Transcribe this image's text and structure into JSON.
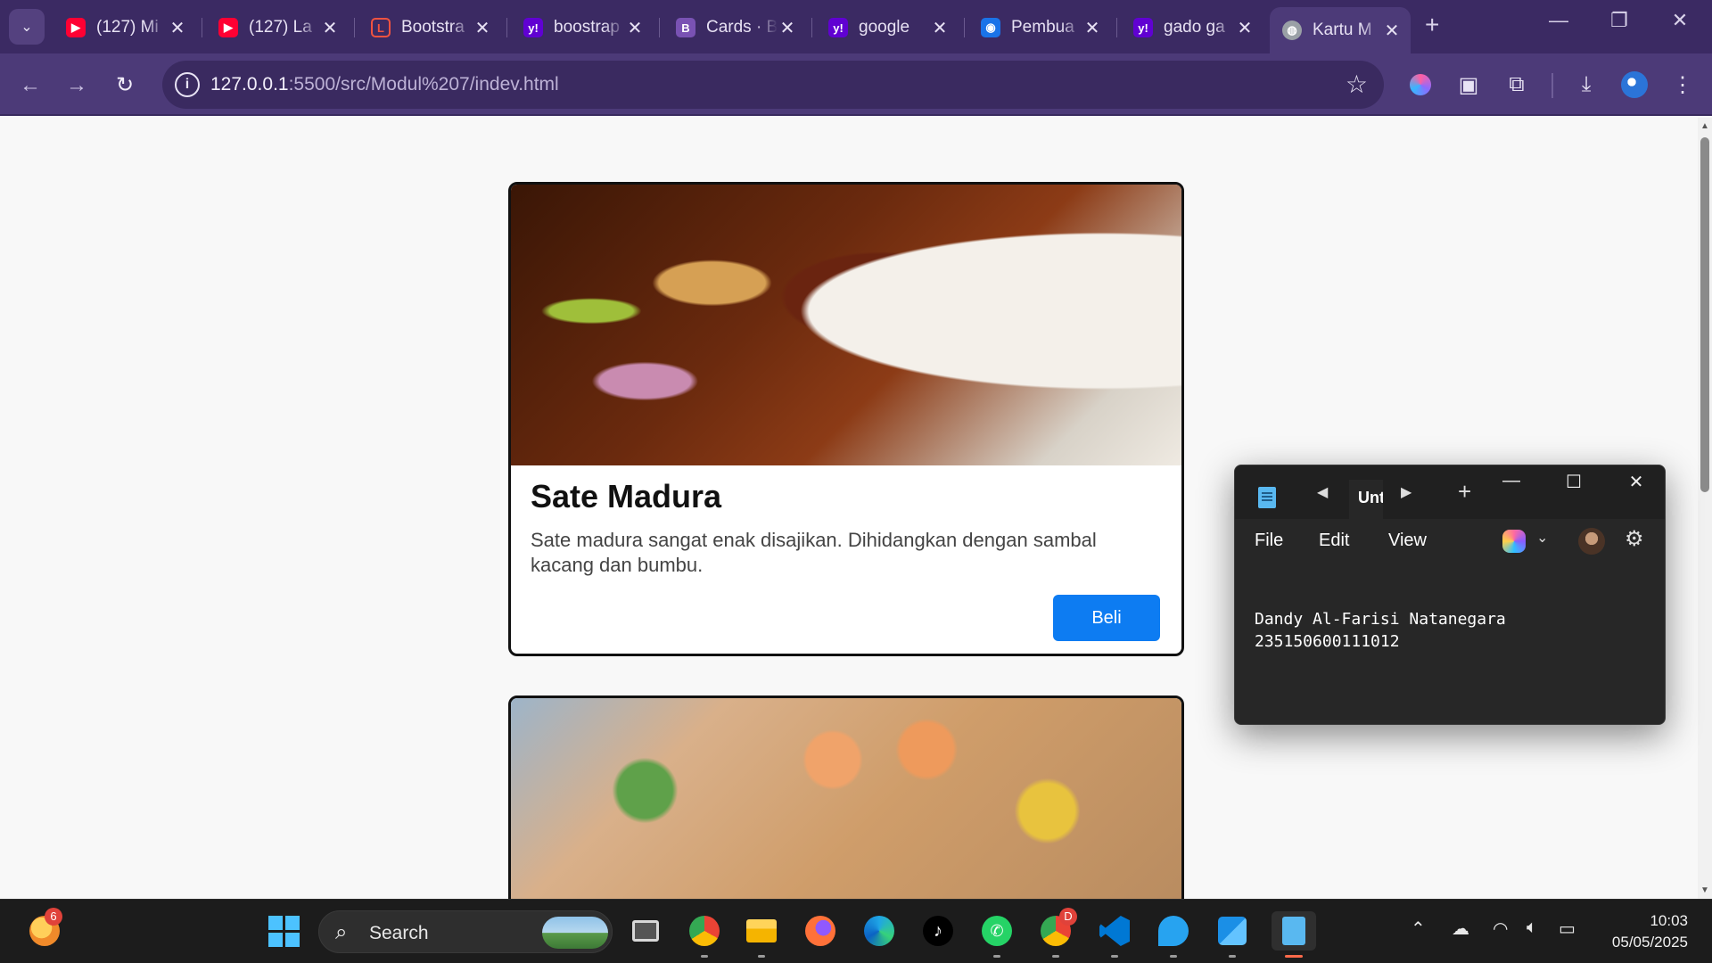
{
  "browser": {
    "tabs": [
      {
        "title": "(127) Mi",
        "favicon": "youtube-icon",
        "color": "#ff0033"
      },
      {
        "title": "(127) La",
        "favicon": "youtube-icon",
        "color": "#ff0033"
      },
      {
        "title": "Bootstra",
        "favicon": "laravel-icon",
        "color": "#f05340"
      },
      {
        "title": "boostrap",
        "favicon": "yahoo-icon",
        "color": "#6001d2"
      },
      {
        "title": "Cards · B",
        "favicon": "bootstrap-icon",
        "color": "#7952b3"
      },
      {
        "title": "google",
        "favicon": "yahoo-icon",
        "color": "#6001d2"
      },
      {
        "title": "Pembua",
        "favicon": "classroom-icon",
        "color": "#1a73e8"
      },
      {
        "title": "gado ga",
        "favicon": "yahoo-icon",
        "color": "#6001d2"
      },
      {
        "title": "Kartu M",
        "favicon": "globe-icon",
        "color": "#9aa0a6",
        "active": true
      }
    ],
    "url_host": "127.0.0.1",
    "url_rest": ":5500/src/Modul%207/indev.html",
    "theme_color": "#4c3a78"
  },
  "cards": [
    {
      "title": "Sate Madura",
      "description": "Sate madura sangat enak disajikan. Dihidangkan dengan sambal kacang dan bumbu.",
      "button": "Beli",
      "image": "satay-photo"
    },
    {
      "image": "fried-rice-photo"
    }
  ],
  "notepad": {
    "tab_title": "Untitled",
    "menu": [
      "File",
      "Edit",
      "View"
    ],
    "lines": [
      "Dandy Al-Farisi Natanegara",
      "235150600111012"
    ]
  },
  "taskbar": {
    "search_placeholder": "Search",
    "widget_badge": "6",
    "chrome2_badge": "D",
    "time": "10:03",
    "date": "05/05/2025"
  }
}
